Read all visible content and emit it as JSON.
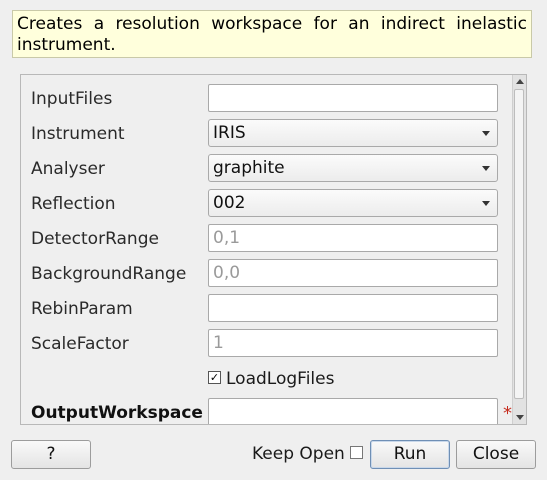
{
  "description": "Creates a resolution workspace for an indirect inelastic instrument.",
  "properties": [
    {
      "label": "InputFiles",
      "kind": "text",
      "value": "",
      "placeholder": ""
    },
    {
      "label": "Instrument",
      "kind": "combo",
      "value": "IRIS"
    },
    {
      "label": "Analyser",
      "kind": "combo",
      "value": "graphite"
    },
    {
      "label": "Reflection",
      "kind": "combo",
      "value": "002"
    },
    {
      "label": "DetectorRange",
      "kind": "text",
      "value": "",
      "placeholder": "0,1"
    },
    {
      "label": "BackgroundRange",
      "kind": "text",
      "value": "",
      "placeholder": "0,0"
    },
    {
      "label": "RebinParam",
      "kind": "text",
      "value": "",
      "placeholder": ""
    },
    {
      "label": "ScaleFactor",
      "kind": "text",
      "value": "",
      "placeholder": "1"
    },
    {
      "label": "LoadLogFiles",
      "kind": "checkbox",
      "checked": true
    },
    {
      "label": "OutputWorkspace",
      "kind": "text",
      "value": "",
      "placeholder": "",
      "required": true,
      "bold": true
    }
  ],
  "footer": {
    "help_label": "?",
    "keep_open_label": "Keep Open",
    "keep_open_checked": false,
    "run_label": "Run",
    "close_label": "Close"
  },
  "icons": {
    "required_marker": "star-icon",
    "combo_arrow": "chevron-down-icon"
  },
  "colors": {
    "description_background": "#ffffdc",
    "required_marker": "#c62d1f"
  }
}
